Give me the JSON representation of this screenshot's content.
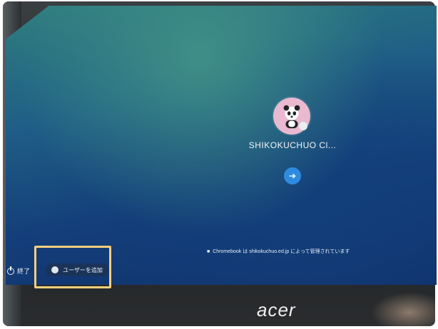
{
  "login": {
    "user_name": "SHIKOKUCHUO Cl...",
    "next_arrow": "➔"
  },
  "footer": {
    "managed_text": "Chromebook は shikokuchuo.ed.jp によって管理されています",
    "folder_icon": "■"
  },
  "shelf": {
    "shutdown_label": "終了",
    "add_user_label": "ユーザーを追加"
  },
  "device": {
    "brand": "acer"
  },
  "colors": {
    "highlight": "#f7cf7e",
    "next_button": "#2f8be0",
    "avatar_bg": "#e9b9cf"
  },
  "icons": {
    "avatar": "panda-avatar-icon",
    "power": "power-icon",
    "add_user": "add-user-icon",
    "managed": "folder-icon",
    "next": "arrow-right-icon"
  }
}
